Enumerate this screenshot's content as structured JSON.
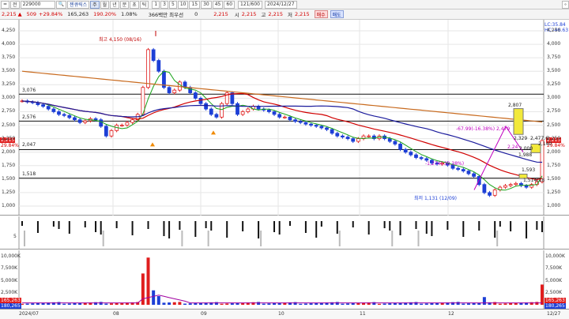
{
  "toolbar": {
    "menu_label": "=",
    "mode_label": "전",
    "code": "229000",
    "search_glyph": "🔍",
    "name": "젠큐릭스",
    "periods": [
      "주",
      "월",
      "년",
      "분",
      "초",
      "틱"
    ],
    "minutes": [
      "1",
      "3",
      "5",
      "10",
      "15",
      "30",
      "45",
      "60"
    ],
    "count": "121",
    "total": "600",
    "date": "2024/12/27",
    "price": "2,215",
    "change": "509",
    "change_rate": "+29.84%",
    "volume": "165,263",
    "volume_ratio": "190.20%",
    "turnover": "1.08%",
    "trade_value": "366백만",
    "priority": "최우선",
    "zero": "0",
    "price2": "2,215",
    "open_label": "시",
    "open": "2,215",
    "high_label": "고",
    "high": "2,215",
    "low_label": "저",
    "low": "2,215",
    "buy_label": "매수",
    "sell_label": "매도"
  },
  "price_axis": {
    "left_ticks": [
      "4,250",
      "4,000",
      "3,750",
      "3,500",
      "3,250",
      "3,000",
      "2,750",
      "2,500",
      "2,250",
      "2,000",
      "1,750",
      "1,500",
      "1,250",
      "1,000"
    ],
    "right_ticks": [
      "4,250",
      "4,000",
      "3,750",
      "3,500",
      "3,250",
      "3,000",
      "2,750",
      "2,500",
      "2,250",
      "2,000",
      "1,750",
      "1,500",
      "1,250",
      "1,000"
    ],
    "left_price_tag": "2,215",
    "left_pct_tag": "29.84%",
    "right_price_tag": "2,215",
    "right_pct_tag": "29.84%",
    "top_right_lc": "LC:35.84",
    "top_right_hc": "HC:-46.63"
  },
  "levels": [
    {
      "label": "3,076",
      "value": 3076
    },
    {
      "label": "2,576",
      "value": 2576
    },
    {
      "label": "2,047",
      "value": 2047
    },
    {
      "label": "1,518",
      "value": 1518
    }
  ],
  "annotations": {
    "high": "최고 4,150 (08/16)",
    "low": "최저 1,131 (12/09)",
    "mid_pct": "-67.99(-16.38%) 2,479",
    "lower_pct": "-1,274(-30.38%)",
    "box_top": "2,807",
    "box_mid1": "2,329",
    "box_mid2": "2,477.6",
    "box_mid3": "2,140",
    "box_mid4": "2,000",
    "box_mid5": "1,988",
    "box_low1": "1,593",
    "box_low2": "1,514(18",
    "pct_small": "2,24"
  },
  "sub_axis": {
    "label": "5"
  },
  "volume_axis": {
    "left_ticks": [
      "10,000K",
      "7,500K",
      "5,000K",
      "2,500K"
    ],
    "right_ticks": [
      "10,000K",
      "7,500K",
      "5,000K",
      "2,500K"
    ],
    "left_tag1": "165,263",
    "left_tag2": "180,265",
    "right_tag1": "165,263",
    "right_tag2": "180,265"
  },
  "time_axis": {
    "labels": [
      "2024/07",
      "08",
      "09",
      "10",
      "11",
      "12",
      "12/27"
    ]
  },
  "chart_data": {
    "type": "candlestick",
    "title": "",
    "x_range": [
      "2024/07",
      "12/27"
    ],
    "ylim": [
      1000,
      4250
    ],
    "close_path": [
      2950,
      2930,
      2920,
      2880,
      2850,
      2800,
      2750,
      2700,
      2680,
      2640,
      2600,
      2550,
      2580,
      2620,
      2600,
      2480,
      2300,
      2400,
      2500,
      2500,
      2550,
      2600,
      2700,
      3200,
      3900,
      3700,
      3500,
      3200,
      3100,
      3150,
      3300,
      3200,
      3100,
      3000,
      2900,
      2800,
      2700,
      2650,
      2900,
      3100,
      2900,
      2700,
      2750,
      2800,
      2850,
      2800,
      2780,
      2750,
      2700,
      2650,
      2650,
      2600,
      2570,
      2550,
      2520,
      2500,
      2480,
      2450,
      2420,
      2350,
      2300,
      2280,
      2250,
      2200,
      2250,
      2300,
      2300,
      2250,
      2300,
      2250,
      2200,
      2150,
      2050,
      2000,
      1950,
      1900,
      1880,
      1850,
      1800,
      1780,
      1800,
      1760,
      1700,
      1680,
      1650,
      1600,
      1550,
      1400,
      1250,
      1200,
      1300,
      1350,
      1380,
      1400,
      1420,
      1380,
      1350,
      1400,
      1450,
      2215
    ]
  }
}
